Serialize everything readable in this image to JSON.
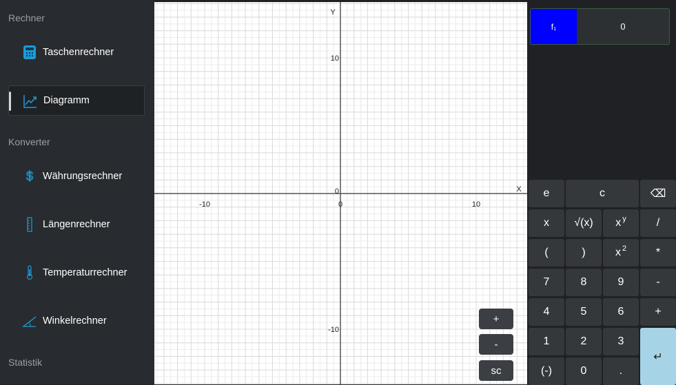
{
  "sidebar": {
    "sections": [
      "Rechner",
      "Konverter",
      "Statistik"
    ],
    "items": [
      {
        "label": "Taschenrechner",
        "icon": "calculator-icon"
      },
      {
        "label": "Diagramm",
        "icon": "chart-line-icon",
        "selected": true
      },
      {
        "label": "Währungsrechner",
        "icon": "dollar-icon"
      },
      {
        "label": "Längenrechner",
        "icon": "ruler-icon"
      },
      {
        "label": "Temperaturrechner",
        "icon": "thermometer-icon"
      },
      {
        "label": "Winkelrechner",
        "icon": "angle-icon"
      }
    ]
  },
  "graph": {
    "x_axis_label": "X",
    "y_axis_label": "Y",
    "tick_x": [
      "-10",
      "0",
      "10"
    ],
    "tick_y": [
      "10",
      "0",
      "-10"
    ],
    "x_range": [
      -19.5,
      19.5
    ],
    "y_range": [
      -20,
      20
    ],
    "zoom_in": "+",
    "zoom_out": "-",
    "reset": "sc"
  },
  "function_entry": {
    "name": "f₁",
    "value": "0",
    "color": "#0000ff"
  },
  "keypad": {
    "rows": [
      [
        "e",
        "c",
        "⌫"
      ],
      [
        "x",
        "√(x)",
        "x^y",
        "/"
      ],
      [
        "(",
        ")",
        "x^2",
        "*"
      ],
      [
        "7",
        "8",
        "9",
        "-"
      ],
      [
        "4",
        "5",
        "6",
        "+"
      ],
      [
        "1",
        "2",
        "3",
        "↵"
      ],
      [
        "(-)",
        "0",
        "."
      ]
    ]
  },
  "colors": {
    "accent_enter": "#a7d3e6",
    "sidebar_bg": "#282b2f",
    "app_bg": "#202124"
  }
}
